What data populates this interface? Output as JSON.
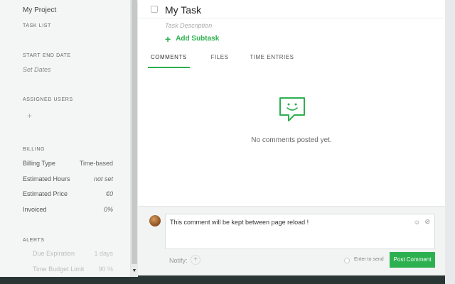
{
  "sidebar": {
    "project": "My Project",
    "task_list_heading": "TASK LIST",
    "start_label": "START",
    "end_label": "END DATE",
    "set_dates": "Set Dates",
    "assigned_heading": "ASSIGNED USERS",
    "assign_add": "+",
    "billing_heading": "BILLING",
    "billing_type_label": "Billing Type",
    "billing_type_value": "Time-based",
    "estimated_hours_label": "Estimated Hours",
    "estimated_hours_value": "not set",
    "estimated_price_label": "Estimated Price",
    "estimated_price_value": "€0",
    "invoiced_label": "Invoiced",
    "invoiced_value": "0%",
    "alerts_heading": "ALERTS",
    "alert_1_label": "Due Expiration",
    "alert_1_value": "1 days",
    "alert_2_label": "Time Budget Limit",
    "alert_2_value": "90 %"
  },
  "task": {
    "title": "My Task",
    "description_placeholder": "Task Description",
    "add_subtask": "Add Subtask"
  },
  "tabs": [
    {
      "label": "COMMENTS",
      "active": true
    },
    {
      "label": "FILES",
      "active": false
    },
    {
      "label": "TIME ENTRIES",
      "active": false
    }
  ],
  "comments": {
    "empty_text": "No comments posted yet."
  },
  "composer": {
    "text": "This comment will be kept between page reload !",
    "notify_label": "Notify:",
    "notify_add": "+",
    "enter_to_send": "Enter to send",
    "post_button": "Post Comment"
  },
  "colors": {
    "accent": "#2db04f"
  },
  "icons": {
    "emoji": "smiley-icon",
    "attach": "paperclip-icon",
    "empty_state": "speech-bubble-smile-icon"
  }
}
